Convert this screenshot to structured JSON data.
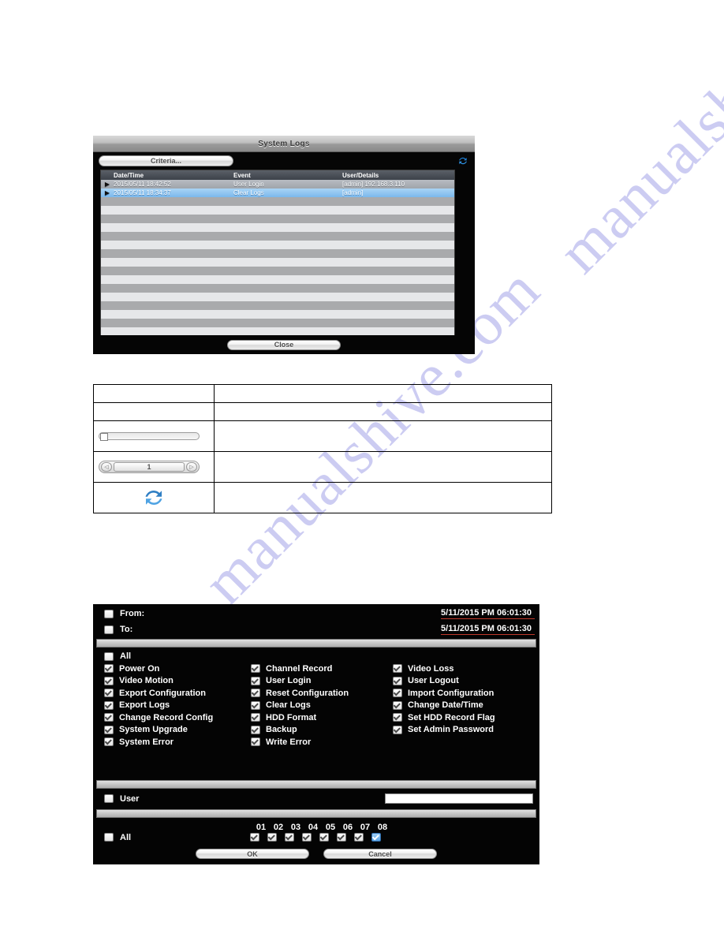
{
  "watermark": {
    "text_a": "manualshive.com",
    "text_b": "manualshive.com",
    "color": "#ccccf2"
  },
  "syslog_dialog": {
    "title": "System Logs",
    "criteria_button": "Criteria...",
    "refresh_icon": "refresh-icon",
    "close_button": "Close",
    "columns": {
      "date": "Date/Time",
      "event": "Event",
      "user": "User/Details"
    },
    "rows": [
      {
        "arrow": "▶",
        "date": "2015/05/11 18:42:52",
        "event": "User Login",
        "user": "[admin] 192.168.3.110",
        "selected": false
      },
      {
        "arrow": "▶",
        "date": "2015/05/11 18:34:37",
        "event": "Clear Logs",
        "user": "[admin]",
        "selected": true
      }
    ],
    "empty_row_count": 16
  },
  "legend_table": {
    "rows": [
      {
        "widget": "none",
        "label": "",
        "description": ""
      },
      {
        "widget": "none",
        "label": "",
        "description": ""
      },
      {
        "widget": "slider",
        "label": "",
        "description": ""
      },
      {
        "widget": "pager",
        "label": "1",
        "description": ""
      },
      {
        "widget": "refresh",
        "label": "",
        "description": ""
      }
    ],
    "pager": {
      "prev_icon": "◁",
      "next_icon": "▷",
      "page_value": "1"
    }
  },
  "criteria_dialog": {
    "from": {
      "label": "From:",
      "value": "5/11/2015 PM 06:01:30",
      "checked": false
    },
    "to": {
      "label": "To:",
      "value": "5/11/2015 PM 06:01:30",
      "checked": false
    },
    "all_events": {
      "label": "All",
      "checked": false
    },
    "events": [
      [
        {
          "label": "Power On",
          "checked": true
        },
        {
          "label": "Channel Record",
          "checked": true
        },
        {
          "label": "Video Loss",
          "checked": true
        }
      ],
      [
        {
          "label": "Video Motion",
          "checked": true
        },
        {
          "label": "User Login",
          "checked": true
        },
        {
          "label": "User Logout",
          "checked": true
        }
      ],
      [
        {
          "label": "Export Configuration",
          "checked": true
        },
        {
          "label": "Reset Configuration",
          "checked": true
        },
        {
          "label": "Import Configuration",
          "checked": true
        }
      ],
      [
        {
          "label": "Export Logs",
          "checked": true
        },
        {
          "label": "Clear Logs",
          "checked": true
        },
        {
          "label": "Change Date/Time",
          "checked": true
        }
      ],
      [
        {
          "label": "Change Record Config",
          "checked": true
        },
        {
          "label": "HDD Format",
          "checked": true
        },
        {
          "label": "Set HDD Record Flag",
          "checked": true
        }
      ],
      [
        {
          "label": "System Upgrade",
          "checked": true
        },
        {
          "label": "Backup",
          "checked": true
        },
        {
          "label": "Set Admin Password",
          "checked": true
        }
      ],
      [
        {
          "label": "System Error",
          "checked": true
        },
        {
          "label": "Write Error",
          "checked": true
        },
        {
          "label": "",
          "checked": false
        }
      ]
    ],
    "user": {
      "label": "User",
      "checked": false,
      "value": "",
      "placeholder": ""
    },
    "channels": {
      "all_label": "All",
      "all_checked": false,
      "numbers": [
        "01",
        "02",
        "03",
        "04",
        "05",
        "06",
        "07",
        "08"
      ],
      "checked": [
        true,
        true,
        true,
        true,
        true,
        true,
        true,
        true
      ],
      "focused_index": 7
    },
    "ok_button": "OK",
    "cancel_button": "Cancel"
  }
}
